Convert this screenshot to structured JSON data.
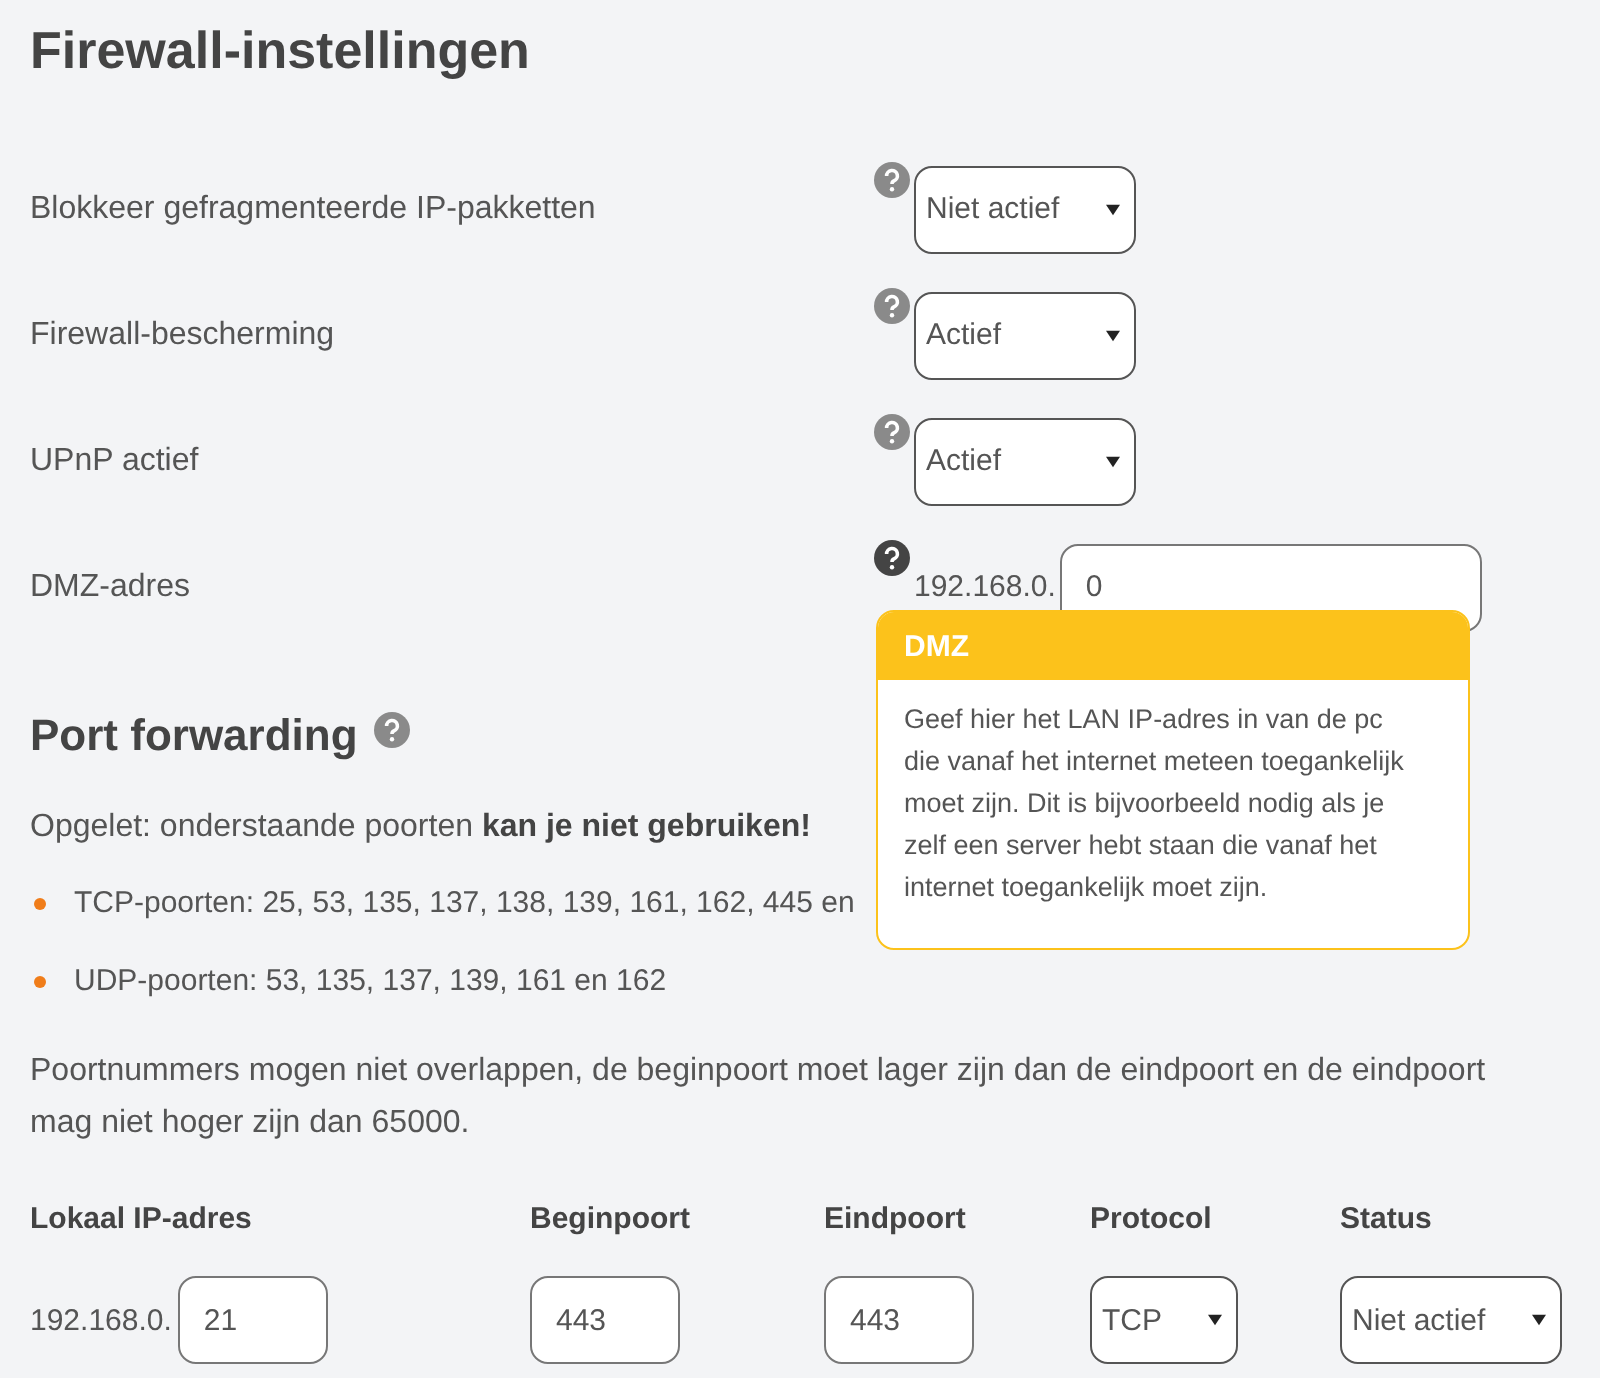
{
  "title": "Firewall-instellingen",
  "settings": [
    {
      "label": "Blokkeer gefragmenteerde IP-pakketten",
      "kind": "select",
      "value": "Niet actief",
      "help_active": false
    },
    {
      "label": "Firewall-bescherming",
      "kind": "select",
      "value": "Actief",
      "help_active": false
    },
    {
      "label": "UPnP actief",
      "kind": "select",
      "value": "Actief",
      "help_active": false
    },
    {
      "label": "DMZ-adres",
      "kind": "ip",
      "prefix": "192.168.0.",
      "value": "0",
      "help_active": true
    }
  ],
  "tooltip": {
    "title": "DMZ",
    "text": "Geef hier het LAN IP-adres in van de pc die vanaf het internet meteen toegankelijk moet zijn. Dit is bijvoorbeeld nodig als je zelf een server hebt staan die vanaf het internet toegankelijk moet zijn."
  },
  "port_forwarding": {
    "title": "Port forwarding",
    "warning": "Opgelet: onderstaande poorten **kan je niet gebruiken!**",
    "bullets": [
      "TCP-poorten: 25, 53, 135, 137, 138, 139, 161, 162, 445 en",
      "UDP-poorten: 53, 135, 137, 139, 161 en 162"
    ],
    "note": "Poortnummers mogen niet overlappen, de beginpoort moet lager zijn dan de eindpoort en de eindpoort mag niet hoger zijn dan 65000.",
    "columns": [
      "Lokaal IP-adres",
      "Beginpoort",
      "Eindpoort",
      "Protocol",
      "Status"
    ],
    "rows": [
      {
        "ip_prefix": "192.168.0.",
        "ip": "21",
        "begin": "443",
        "end": "443",
        "protocol": "TCP",
        "status": "Niet actief"
      }
    ]
  }
}
